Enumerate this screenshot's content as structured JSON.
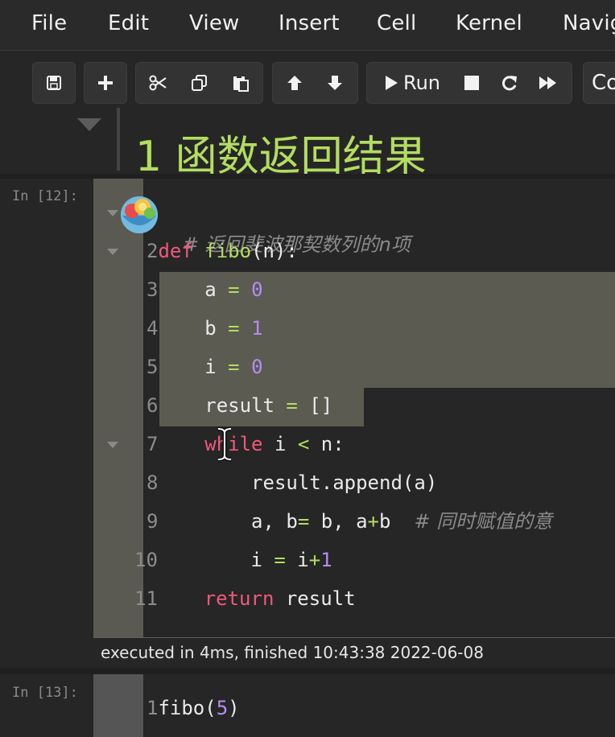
{
  "menu": [
    "File",
    "Edit",
    "View",
    "Insert",
    "Cell",
    "Kernel",
    "Navig"
  ],
  "toolbar": {
    "run_label": "Run",
    "cut_off_label": "Co",
    "buttons": [
      "save-icon",
      "plus-icon",
      "cut-icon",
      "copy-icon",
      "paste-icon",
      "arrow-up-icon",
      "arrow-down-icon",
      "run-icon",
      "stop-icon",
      "restart-icon",
      "fast-forward-icon"
    ]
  },
  "heading": {
    "text": "1  函数返回结果"
  },
  "cell1": {
    "prompt": "In [12]:",
    "lines": [
      {
        "num": "",
        "text": "# 返回斐波那契数列的n项"
      },
      {
        "num": "2",
        "text": "def fibo(n):"
      },
      {
        "num": "3",
        "text": "    a = 0"
      },
      {
        "num": "4",
        "text": "    b = 1"
      },
      {
        "num": "5",
        "text": "    i = 0"
      },
      {
        "num": "6",
        "text": "    result = []"
      },
      {
        "num": "7",
        "text": "    while i < n:"
      },
      {
        "num": "8",
        "text": "        result.append(a)"
      },
      {
        "num": "9",
        "text": "        a, b= b, a+b  # 同时赋值的意"
      },
      {
        "num": "10",
        "text": "        i = i+1"
      },
      {
        "num": "11",
        "text": "    return result"
      }
    ],
    "status": "executed in 4ms, finished 10:43:38 2022-06-08"
  },
  "cell2": {
    "prompt": "In [13]:",
    "lines": [
      {
        "num": "1",
        "text": "fibo(5)"
      }
    ]
  },
  "colors": {
    "keyword": "#f2577b",
    "function": "#b4dc60",
    "number": "#b58cf5",
    "comment": "#8a8a8a"
  }
}
